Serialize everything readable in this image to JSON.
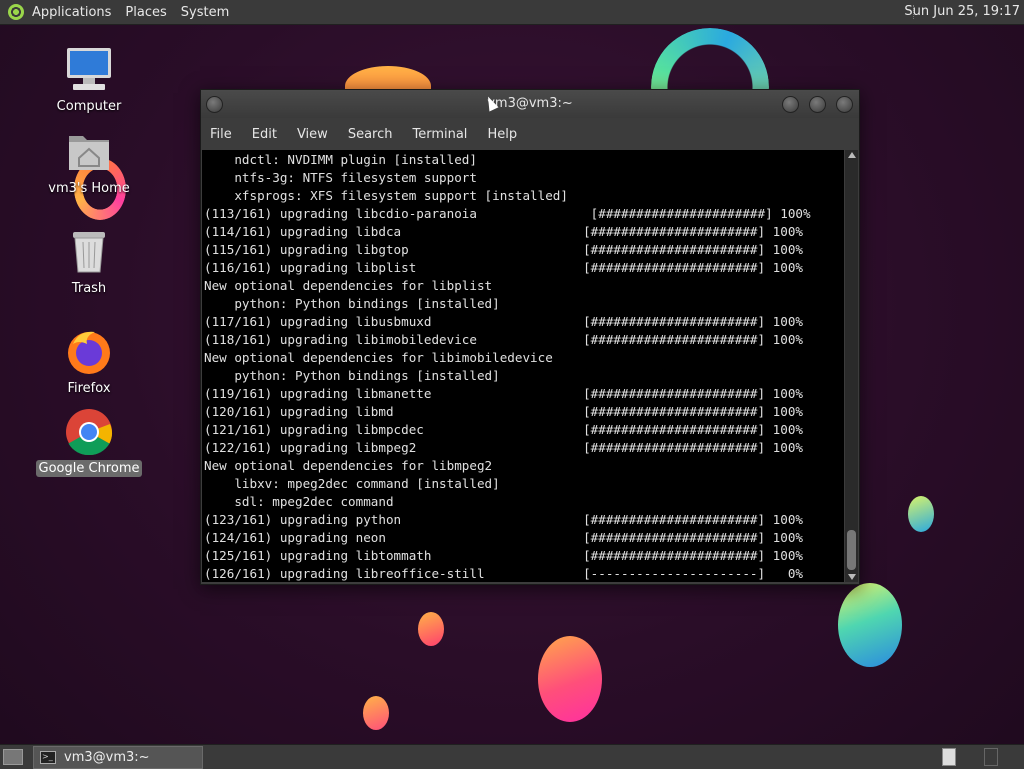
{
  "top_panel": {
    "menus": [
      "Applications",
      "Places",
      "System"
    ],
    "clock": "Sun Jun 25, 19:17"
  },
  "desktop_icons": [
    {
      "label": "Computer",
      "icon": "computer-icon"
    },
    {
      "label": "vm3's Home",
      "icon": "home-folder-icon"
    },
    {
      "label": "Trash",
      "icon": "trash-icon"
    },
    {
      "label": "Firefox",
      "icon": "firefox-icon"
    },
    {
      "label": "Google Chrome",
      "icon": "chrome-icon",
      "selected": true
    }
  ],
  "window": {
    "title": "vm3@vm3:~",
    "menu": [
      "File",
      "Edit",
      "View",
      "Search",
      "Terminal",
      "Help"
    ],
    "terminal_lines": [
      "    ndctl: NVDIMM plugin [installed]",
      "    ntfs-3g: NTFS filesystem support",
      "    xfsprogs: XFS filesystem support [installed]",
      "(113/161) upgrading libcdio-paranoia               [######################] 100%",
      "(114/161) upgrading libdca                        [######################] 100%",
      "(115/161) upgrading libgtop                       [######################] 100%",
      "(116/161) upgrading libplist                      [######################] 100%",
      "New optional dependencies for libplist",
      "    python: Python bindings [installed]",
      "(117/161) upgrading libusbmuxd                    [######################] 100%",
      "(118/161) upgrading libimobiledevice              [######################] 100%",
      "New optional dependencies for libimobiledevice",
      "    python: Python bindings [installed]",
      "(119/161) upgrading libmanette                    [######################] 100%",
      "(120/161) upgrading libmd                         [######################] 100%",
      "(121/161) upgrading libmpcdec                     [######################] 100%",
      "(122/161) upgrading libmpeg2                      [######################] 100%",
      "New optional dependencies for libmpeg2",
      "    libxv: mpeg2dec command [installed]",
      "    sdl: mpeg2dec command",
      "(123/161) upgrading python                        [######################] 100%",
      "(124/161) upgrading neon                          [######################] 100%",
      "(125/161) upgrading libtommath                    [######################] 100%",
      "(126/161) upgrading libreoffice-still             [----------------------]   0%"
    ]
  },
  "taskbar": {
    "task_label": "vm3@vm3:~"
  },
  "colors": {
    "desktop_bg": "#2a0d28",
    "panel_bg": "#3a3a3a",
    "terminal_bg": "#000000",
    "terminal_fg": "#e0e0e0"
  }
}
